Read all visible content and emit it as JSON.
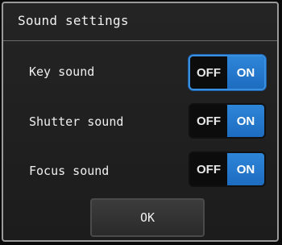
{
  "dialog": {
    "title": "Sound settings",
    "settings": [
      {
        "label": "Key sound",
        "off_label": "OFF",
        "on_label": "ON",
        "state": "ON",
        "focused": true
      },
      {
        "label": "Shutter sound",
        "off_label": "OFF",
        "on_label": "ON",
        "state": "ON",
        "focused": false
      },
      {
        "label": "Focus sound",
        "off_label": "OFF",
        "on_label": "ON",
        "state": "ON",
        "focused": false
      }
    ],
    "ok_label": "OK"
  },
  "colors": {
    "accent_on": "#2e86d8",
    "focus_border": "#3a90e0",
    "background": "#1c1c1c"
  }
}
